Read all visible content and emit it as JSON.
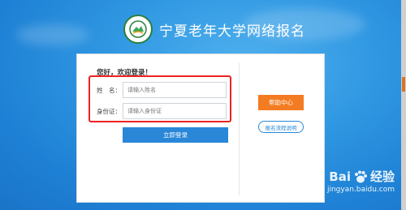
{
  "header": {
    "title": "宁夏老年大学网络报名"
  },
  "login": {
    "greeting": "您好，欢迎登录！",
    "name_label": "姓　名：",
    "name_placeholder": "请输入姓名",
    "id_label": "身份证：",
    "id_placeholder": "请输入身份证",
    "submit_label": "立即登录"
  },
  "side": {
    "help_label": "帮助中心",
    "process_label": "报名流程说明"
  },
  "watermark": {
    "brand_left": "Bai",
    "brand_right": "经验",
    "url": "jingyan.baidu.com"
  },
  "colors": {
    "background": "#2f97e2",
    "primary_button": "#2a87d8",
    "help_button": "#f37b21",
    "highlight_box": "#e22222"
  }
}
